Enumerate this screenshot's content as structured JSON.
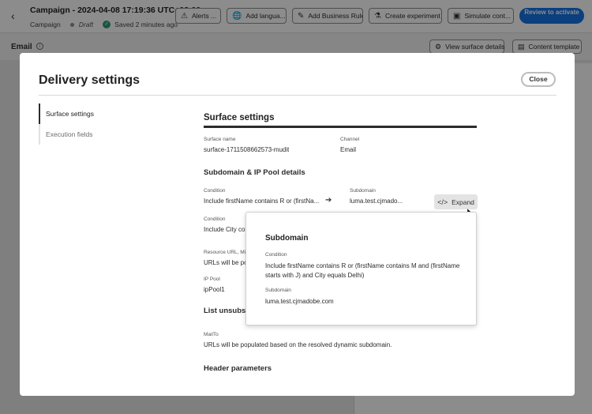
{
  "header": {
    "campaign_title": "Campaign - 2024-04-08 17:19:36 UTC+02:00",
    "campaign_label": "Campaign",
    "status": "Draft",
    "saved": "Saved 2 minutes ago",
    "buttons": {
      "alerts": "Alerts ...",
      "add_language": "Add langua...",
      "add_business_rule": "Add Business Rule",
      "create_experiment": "Create experiment",
      "simulate_content": "Simulate cont..."
    },
    "review": "Review to activate"
  },
  "subheader": {
    "title": "Email",
    "view_surface_details": "View surface details",
    "content_template": "Content template"
  },
  "dialog": {
    "title": "Delivery settings",
    "close": "Close",
    "nav": [
      "Surface settings",
      "Execution fields"
    ],
    "section_title": "Surface settings",
    "surface_name_label": "Surface name",
    "surface_name": "surface-1711508662573-mudit",
    "channel_label": "Channel",
    "channel": "Email",
    "subdomain_title": "Subdomain & IP Pool details",
    "condition_label": "Condition",
    "condition_1": "Include firstName contains R or (firstNa...",
    "subdomain_label": "Subdomain",
    "subdomain_1": "luma.test.cjmado...",
    "expand": "Expand",
    "condition_label_2": "Condition",
    "condition_2": "Include City co",
    "resource_url_label": "Resource URL, Mi",
    "resource_url_value": "URLs will be po",
    "ip_pool_label": "IP Pool",
    "ip_pool": "ipPool1",
    "list_unsub_title": "List unsubscri",
    "mailto_label": "MailTo",
    "mailto_value": "URLs will be populated based on the resolved dynamic subdomain.",
    "header_params_title": "Header parameters"
  },
  "popover": {
    "title": "Subdomain",
    "condition_label": "Condition",
    "condition": "Include firstName contains R or (firstName contains M and (firstName starts with J) and City equals Delhi)",
    "subdomain_label": "Subdomain",
    "subdomain": "luma.test.cjmadobe.com"
  },
  "colors": {
    "accent": "#1473e6",
    "saved_check": "#2d9d78"
  }
}
